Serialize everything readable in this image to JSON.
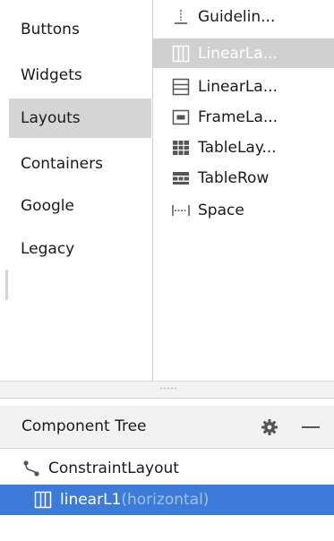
{
  "palette": {
    "categories": [
      {
        "label": "Buttons",
        "selected": false
      },
      {
        "label": "Widgets",
        "selected": false
      },
      {
        "label": "Layouts",
        "selected": true
      },
      {
        "label": "Containers",
        "selected": false
      },
      {
        "label": "Google",
        "selected": false
      },
      {
        "label": "Legacy",
        "selected": false
      }
    ],
    "items": [
      {
        "label": "Guidelin...",
        "icon": "guideline-icon",
        "selected": false
      },
      {
        "label": "LinearLa...",
        "icon": "linear-layout-horizontal-icon",
        "selected": true
      },
      {
        "label": "LinearLa...",
        "icon": "linear-layout-vertical-icon",
        "selected": false
      },
      {
        "label": "FrameLa...",
        "icon": "frame-layout-icon",
        "selected": false
      },
      {
        "label": "TableLay...",
        "icon": "table-layout-icon",
        "selected": false
      },
      {
        "label": "TableRow",
        "icon": "table-row-icon",
        "selected": false
      },
      {
        "label": "Space",
        "icon": "space-icon",
        "selected": false
      }
    ]
  },
  "component_tree": {
    "title": "Component Tree",
    "settings_icon": "gear-icon",
    "minimize_icon": "minimize-icon",
    "nodes": [
      {
        "label": "ConstraintLayout",
        "icon": "constraint-layout-icon",
        "hint": "",
        "depth": 0,
        "selected": false
      },
      {
        "label": "linearL1",
        "icon": "linear-layout-horizontal-icon",
        "hint": "(horizontal)",
        "depth": 1,
        "selected": true
      }
    ]
  },
  "colors": {
    "selection_blue": "#3d7bd9",
    "palette_selected": "#d0d0d0",
    "category_selected": "#d5d5d5",
    "hint_text": "#9ec1f1",
    "icon_gray": "#555555"
  }
}
